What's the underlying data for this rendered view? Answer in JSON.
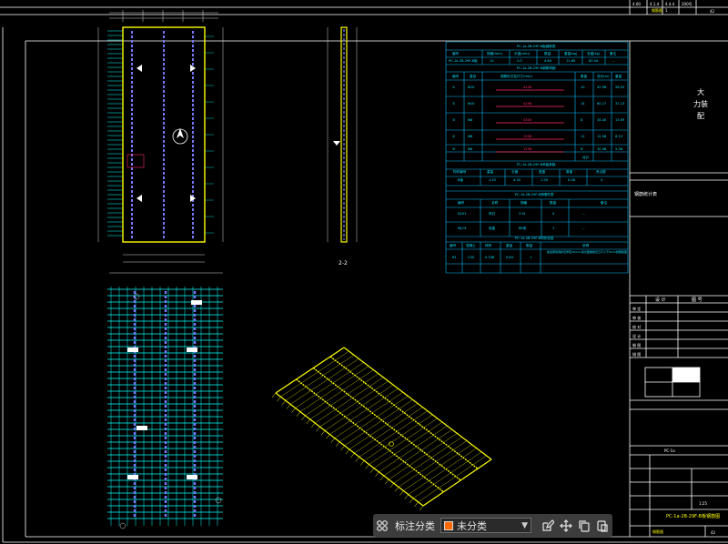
{
  "colors": {
    "background": "#000000",
    "frame": "#ffffff",
    "slab_outline": "#ffff00",
    "rebar_main": "#7777ff",
    "rebar_grid": "#00ffff",
    "table_lines": "#00bfff",
    "dims": "#cfcfcf",
    "highlight_red": "#ff2a6a",
    "toolbar_swatch": "#ff6a00"
  },
  "sheet": {
    "top_strip": [
      "4.00",
      "4.1.4",
      "4.4.4",
      "200号",
      "1",
      "钢筋图"
    ],
    "title_vertical": [
      "大",
      "力装",
      "配"
    ],
    "sheet_no_top": "42",
    "sheet_no_bottom": "42",
    "drawing_code": "PC-1a-2B-29F-B板钢筋图",
    "scale": "1:25",
    "doc_label": "钢筋统计表",
    "row_labels": [
      "审 定",
      "审 核",
      "校 对",
      "设 计",
      "制 图",
      "描 图"
    ],
    "block_header": [
      "设 计",
      "图 号"
    ],
    "block_info": "PC-1a"
  },
  "views": {
    "section_label": "2-2",
    "north_symbol": "N"
  },
  "tables": {
    "t1_title": "PC-1a-2B-29F-B板钢筋表",
    "t1_headers": [
      "编号",
      "规格(mm)",
      "长度(mm)",
      "数量",
      "重量(kg)",
      "总重(kg)",
      "备注"
    ],
    "t1_row": [
      "PC-1a-2B-29F-B板",
      "10",
      "2.0",
      "4.80",
      "11.60",
      "83.54",
      "--"
    ],
    "t2_title": "PC-1a-2B-29F-B钢筋明细",
    "t2_headers": [
      "编号",
      "直径",
      "钢筋形式及尺寸(mm)",
      "数量",
      "总长(m)",
      "重量"
    ],
    "t2_rows": [
      [
        "①",
        "Φ10",
        "4298",
        "10",
        "42.98",
        "26.52"
      ],
      [
        "②",
        "Φ10",
        "4298",
        "14",
        "60.17",
        "37.13"
      ],
      [
        "③",
        "Φ8",
        "4300",
        "8",
        "34.40",
        "13.59"
      ],
      [
        "④",
        "Φ8",
        "1298",
        "12",
        "15.58",
        "6.15"
      ],
      [
        "⑤",
        "Φ6",
        "1298",
        "8",
        "10.38",
        "5.38"
      ]
    ],
    "t2_total": "合计",
    "t3_title": "PC-1a-2B-29F-B吊装参数",
    "t3_headers": [
      "构件编号",
      "重量",
      "长度",
      "宽度",
      "厚度",
      "吊点数"
    ],
    "t3_row": [
      "B板",
      "1.52",
      "4.30",
      "1.30",
      "0.06",
      "4"
    ],
    "t4_title": "PC-1a-2B-29F-B预埋件表",
    "t4_headers": [
      "编号",
      "名称",
      "规格",
      "数量",
      "备注"
    ],
    "t4_rows": [
      [
        "DJ-01",
        "吊钉",
        "2.5t",
        "4",
        "--"
      ],
      [
        "MJ-01",
        "线盒",
        "86型",
        "1",
        "--"
      ]
    ],
    "t5_title": "PC-1a-2B-29F-B构件信息",
    "t5_headers": [
      "编号",
      "混凝土",
      "体积",
      "重量",
      "数量",
      "说明"
    ],
    "t5_row": [
      "B1",
      "C30",
      "0.336",
      "0.84",
      "1",
      "板底钢筋保护层厚度15mm,叠合面做成凹凸不小于4mm的粗糙面"
    ]
  },
  "toolbar": {
    "grid_icon": "grid-icon",
    "label": "标注分类",
    "select_value": "未分类",
    "swatch_color": "#ff6a00",
    "edit_icon": "edit-icon",
    "move_icon": "move-icon",
    "copy_icon": "copy-icon",
    "paste_icon": "paste-icon"
  }
}
